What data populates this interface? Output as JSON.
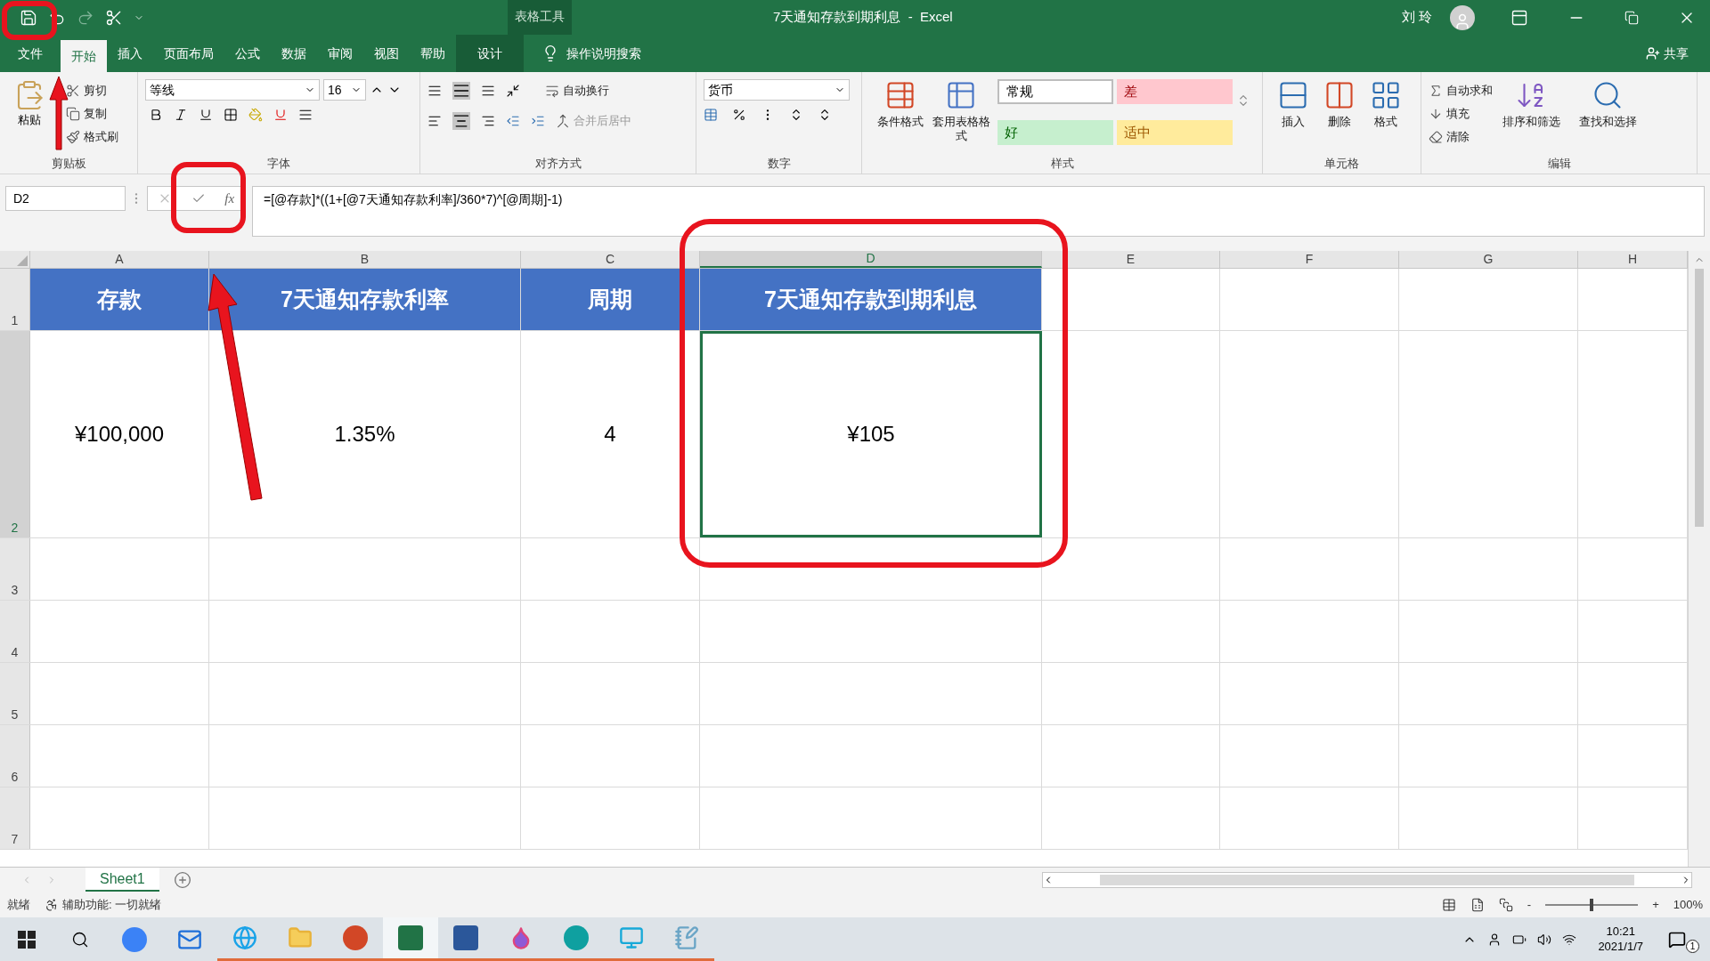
{
  "title_bar": {
    "context_tab": "表格工具",
    "title": "7天通知存款到期利息  -  Excel",
    "user": "刘 玲"
  },
  "menu_tabs": [
    {
      "label": "文件",
      "selected": false,
      "kind": "file"
    },
    {
      "label": "开始",
      "selected": true,
      "kind": "normal"
    },
    {
      "label": "插入",
      "selected": false,
      "kind": "normal"
    },
    {
      "label": "页面布局",
      "selected": false,
      "kind": "normal"
    },
    {
      "label": "公式",
      "selected": false,
      "kind": "normal"
    },
    {
      "label": "数据",
      "selected": false,
      "kind": "normal"
    },
    {
      "label": "审阅",
      "selected": false,
      "kind": "normal"
    },
    {
      "label": "视图",
      "selected": false,
      "kind": "normal"
    },
    {
      "label": "帮助",
      "selected": false,
      "kind": "normal"
    },
    {
      "label": "设计",
      "selected": false,
      "kind": "contextual"
    }
  ],
  "search": {
    "placeholder": "操作说明搜索"
  },
  "share": "共享",
  "ribbon": {
    "clipboard": {
      "paste": "粘贴",
      "cut": "剪切",
      "copy": "复制",
      "format_painter": "格式刷",
      "label": "剪贴板"
    },
    "font": {
      "font_name": "等线",
      "font_size": "16",
      "label": "字体"
    },
    "alignment": {
      "wrap": "自动换行",
      "merge": "合并后居中",
      "label": "对齐方式"
    },
    "number": {
      "format": "货币",
      "label": "数字"
    },
    "styles": {
      "conditional": "条件格式",
      "table_format": "套用表格格式",
      "cell_styles": [
        {
          "label": "常规",
          "kind": "normal",
          "color": "#ffffff"
        },
        {
          "label": "差",
          "kind": "bad",
          "color": "#ffc7ce"
        },
        {
          "label": "好",
          "kind": "good",
          "color": "#c6efce"
        },
        {
          "label": "适中",
          "kind": "neutral",
          "color": "#ffeb9c"
        }
      ],
      "label": "样式"
    },
    "cells": {
      "insert": "插入",
      "delete": "删除",
      "format": "格式",
      "label": "单元格"
    },
    "editing": {
      "autosum": "自动求和",
      "fill": "填充",
      "clear": "清除",
      "sort": "排序和筛选",
      "find": "查找和选择",
      "label": "编辑"
    }
  },
  "formula_bar": {
    "name_box": "D2",
    "formula": "=[@存款]*((1+[@7天通知存款利率]/360*7)^[@周期]-1)",
    "fx": "fx"
  },
  "columns": [
    {
      "label": "A",
      "selected": false
    },
    {
      "label": "B",
      "selected": false
    },
    {
      "label": "C",
      "selected": false
    },
    {
      "label": "D",
      "selected": true
    },
    {
      "label": "E",
      "selected": false
    },
    {
      "label": "F",
      "selected": false
    },
    {
      "label": "G",
      "selected": false
    },
    {
      "label": "H",
      "selected": false
    }
  ],
  "rows": [
    {
      "number": "1",
      "selected": false,
      "cells": [
        {
          "text": "存款",
          "kind": "header",
          "selected": false
        },
        {
          "text": "7天通知存款利率",
          "kind": "header",
          "selected": false
        },
        {
          "text": "周期",
          "kind": "header",
          "selected": false
        },
        {
          "text": "7天通知存款到期利息",
          "kind": "header",
          "selected": false
        }
      ]
    },
    {
      "number": "2",
      "selected": true,
      "cells": [
        {
          "text": "¥100,000",
          "kind": "data",
          "selected": false
        },
        {
          "text": "1.35%",
          "kind": "data",
          "selected": false
        },
        {
          "text": "4",
          "kind": "data",
          "selected": false
        },
        {
          "text": "¥105",
          "kind": "data",
          "selected": true
        }
      ]
    },
    {
      "number": "3",
      "selected": false,
      "cells": []
    },
    {
      "number": "4",
      "selected": false,
      "cells": []
    },
    {
      "number": "5",
      "selected": false,
      "cells": []
    },
    {
      "number": "6",
      "selected": false,
      "cells": []
    },
    {
      "number": "7",
      "selected": false,
      "cells": []
    }
  ],
  "sheet_tabs": [
    {
      "label": "Sheet1",
      "selected": true
    }
  ],
  "status_bar": {
    "ready": "就绪",
    "accessibility": "辅助功能: 一切就绪",
    "zoom_minus": "-",
    "zoom_plus": "+",
    "zoom_slider": {
      "level": 0.5
    },
    "zoom": "100%"
  },
  "taskbar": {
    "apps": [
      {
        "kind": "circle",
        "running": false,
        "selected": false
      },
      {
        "kind": "mail",
        "running": false,
        "selected": false
      },
      {
        "kind": "browser",
        "running": true,
        "selected": false
      },
      {
        "kind": "folder",
        "running": true,
        "selected": false
      },
      {
        "kind": "slides",
        "running": true,
        "selected": false
      },
      {
        "kind": "sheet",
        "running": true,
        "selected": true
      },
      {
        "kind": "doc",
        "running": true,
        "selected": false
      },
      {
        "kind": "drop",
        "running": true,
        "selected": false
      },
      {
        "kind": "edge",
        "running": true,
        "selected": false
      },
      {
        "kind": "remote",
        "running": true,
        "selected": false
      },
      {
        "kind": "notes",
        "running": true,
        "selected": false
      }
    ],
    "time": "10:21",
    "date": "2021/1/7",
    "notifications": "1"
  }
}
